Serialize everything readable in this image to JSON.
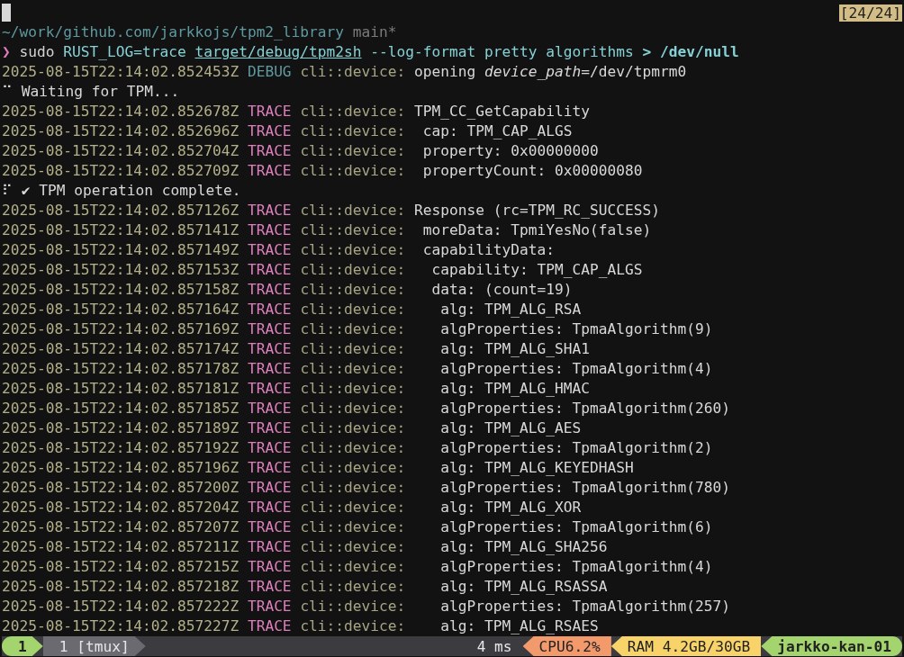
{
  "top_bar": {
    "scroll_position": "[24/24]"
  },
  "prompt": {
    "path": "~/work/github.com/jarkkojs/tpm2_library",
    "branch": "main*",
    "symbol": "❯",
    "command": [
      {
        "kind": "plain",
        "text": "sudo "
      },
      {
        "kind": "env",
        "text": "RUST_LOG=trace "
      },
      {
        "kind": "path",
        "text": "target/debug/tpm2sh"
      },
      {
        "kind": "env",
        "text": " --log-format pretty algorithms "
      },
      {
        "kind": "redirect",
        "text": "> /dev/null"
      }
    ]
  },
  "lines": [
    {
      "kind": "log",
      "timestamp": "2025-08-15T22:14:02.852453Z",
      "level": "DEBUG",
      "target": "cli::device:",
      "message": "opening *device_path*=/dev/tpmrm0"
    },
    {
      "kind": "spinner",
      "glyph": "⠉",
      "text": "Waiting for TPM..."
    },
    {
      "kind": "log",
      "timestamp": "2025-08-15T22:14:02.852678Z",
      "level": "TRACE",
      "target": "cli::device:",
      "message": "TPM_CC_GetCapability"
    },
    {
      "kind": "log",
      "timestamp": "2025-08-15T22:14:02.852696Z",
      "level": "TRACE",
      "target": "cli::device:",
      "message": " cap: TPM_CAP_ALGS"
    },
    {
      "kind": "log",
      "timestamp": "2025-08-15T22:14:02.852704Z",
      "level": "TRACE",
      "target": "cli::device:",
      "message": " property: 0x00000000"
    },
    {
      "kind": "log",
      "timestamp": "2025-08-15T22:14:02.852709Z",
      "level": "TRACE",
      "target": "cli::device:",
      "message": " propertyCount: 0x00000080"
    },
    {
      "kind": "spinner",
      "glyph": "⠏",
      "text": "✔ TPM operation complete."
    },
    {
      "kind": "log",
      "timestamp": "2025-08-15T22:14:02.857126Z",
      "level": "TRACE",
      "target": "cli::device:",
      "message": "Response (rc=TPM_RC_SUCCESS)"
    },
    {
      "kind": "log",
      "timestamp": "2025-08-15T22:14:02.857141Z",
      "level": "TRACE",
      "target": "cli::device:",
      "message": " moreData: TpmiYesNo(false)"
    },
    {
      "kind": "log",
      "timestamp": "2025-08-15T22:14:02.857149Z",
      "level": "TRACE",
      "target": "cli::device:",
      "message": " capabilityData:"
    },
    {
      "kind": "log",
      "timestamp": "2025-08-15T22:14:02.857153Z",
      "level": "TRACE",
      "target": "cli::device:",
      "message": "  capability: TPM_CAP_ALGS"
    },
    {
      "kind": "log",
      "timestamp": "2025-08-15T22:14:02.857158Z",
      "level": "TRACE",
      "target": "cli::device:",
      "message": "  data: (count=19)"
    },
    {
      "kind": "log",
      "timestamp": "2025-08-15T22:14:02.857164Z",
      "level": "TRACE",
      "target": "cli::device:",
      "message": "   alg: TPM_ALG_RSA"
    },
    {
      "kind": "log",
      "timestamp": "2025-08-15T22:14:02.857169Z",
      "level": "TRACE",
      "target": "cli::device:",
      "message": "   algProperties: TpmaAlgorithm(9)"
    },
    {
      "kind": "log",
      "timestamp": "2025-08-15T22:14:02.857174Z",
      "level": "TRACE",
      "target": "cli::device:",
      "message": "   alg: TPM_ALG_SHA1"
    },
    {
      "kind": "log",
      "timestamp": "2025-08-15T22:14:02.857178Z",
      "level": "TRACE",
      "target": "cli::device:",
      "message": "   algProperties: TpmaAlgorithm(4)"
    },
    {
      "kind": "log",
      "timestamp": "2025-08-15T22:14:02.857181Z",
      "level": "TRACE",
      "target": "cli::device:",
      "message": "   alg: TPM_ALG_HMAC"
    },
    {
      "kind": "log",
      "timestamp": "2025-08-15T22:14:02.857185Z",
      "level": "TRACE",
      "target": "cli::device:",
      "message": "   algProperties: TpmaAlgorithm(260)"
    },
    {
      "kind": "log",
      "timestamp": "2025-08-15T22:14:02.857189Z",
      "level": "TRACE",
      "target": "cli::device:",
      "message": "   alg: TPM_ALG_AES"
    },
    {
      "kind": "log",
      "timestamp": "2025-08-15T22:14:02.857192Z",
      "level": "TRACE",
      "target": "cli::device:",
      "message": "   algProperties: TpmaAlgorithm(2)"
    },
    {
      "kind": "log",
      "timestamp": "2025-08-15T22:14:02.857196Z",
      "level": "TRACE",
      "target": "cli::device:",
      "message": "   alg: TPM_ALG_KEYEDHASH"
    },
    {
      "kind": "log",
      "timestamp": "2025-08-15T22:14:02.857200Z",
      "level": "TRACE",
      "target": "cli::device:",
      "message": "   algProperties: TpmaAlgorithm(780)"
    },
    {
      "kind": "log",
      "timestamp": "2025-08-15T22:14:02.857204Z",
      "level": "TRACE",
      "target": "cli::device:",
      "message": "   alg: TPM_ALG_XOR"
    },
    {
      "kind": "log",
      "timestamp": "2025-08-15T22:14:02.857207Z",
      "level": "TRACE",
      "target": "cli::device:",
      "message": "   algProperties: TpmaAlgorithm(6)"
    },
    {
      "kind": "log",
      "timestamp": "2025-08-15T22:14:02.857211Z",
      "level": "TRACE",
      "target": "cli::device:",
      "message": "   alg: TPM_ALG_SHA256"
    },
    {
      "kind": "log",
      "timestamp": "2025-08-15T22:14:02.857215Z",
      "level": "TRACE",
      "target": "cli::device:",
      "message": "   algProperties: TpmaAlgorithm(4)"
    },
    {
      "kind": "log",
      "timestamp": "2025-08-15T22:14:02.857218Z",
      "level": "TRACE",
      "target": "cli::device:",
      "message": "   alg: TPM_ALG_RSASSA"
    },
    {
      "kind": "log",
      "timestamp": "2025-08-15T22:14:02.857222Z",
      "level": "TRACE",
      "target": "cli::device:",
      "message": "   algProperties: TpmaAlgorithm(257)"
    },
    {
      "kind": "log",
      "timestamp": "2025-08-15T22:14:02.857227Z",
      "level": "TRACE",
      "target": "cli::device:",
      "message": "   alg: TPM_ALG_RSAES"
    }
  ],
  "status_bar": {
    "left": [
      {
        "kind": "session",
        "text": "1"
      },
      {
        "kind": "window",
        "text": "1 [tmux]"
      }
    ],
    "right": [
      {
        "kind": "plain",
        "text": "4 ms"
      },
      {
        "kind": "cpu",
        "text": "CPU6.2%"
      },
      {
        "kind": "ram",
        "text": "RAM 4.2GB/30GB"
      },
      {
        "kind": "host",
        "text": "jarkko-kan-01"
      }
    ]
  }
}
